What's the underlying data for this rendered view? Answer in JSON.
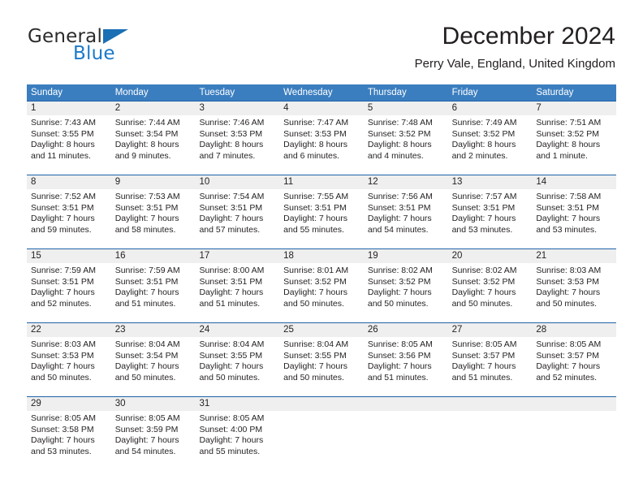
{
  "brand": {
    "name_part1": "General",
    "name_part2": "Blue",
    "triangle_color": "#1a6fb5",
    "blue_color": "#1b79c9"
  },
  "header": {
    "title": "December 2024",
    "subtitle": "Perry Vale, England, United Kingdom"
  },
  "colors": {
    "header_row_bg": "#3b7ebf",
    "week_border": "#1f63a8",
    "day_band_bg": "#efefef",
    "text": "#231f20"
  },
  "weekdays": [
    "Sunday",
    "Monday",
    "Tuesday",
    "Wednesday",
    "Thursday",
    "Friday",
    "Saturday"
  ],
  "weeks": [
    [
      {
        "day": "1",
        "sunrise": "Sunrise: 7:43 AM",
        "sunset": "Sunset: 3:55 PM",
        "daylight1": "Daylight: 8 hours",
        "daylight2": "and 11 minutes."
      },
      {
        "day": "2",
        "sunrise": "Sunrise: 7:44 AM",
        "sunset": "Sunset: 3:54 PM",
        "daylight1": "Daylight: 8 hours",
        "daylight2": "and 9 minutes."
      },
      {
        "day": "3",
        "sunrise": "Sunrise: 7:46 AM",
        "sunset": "Sunset: 3:53 PM",
        "daylight1": "Daylight: 8 hours",
        "daylight2": "and 7 minutes."
      },
      {
        "day": "4",
        "sunrise": "Sunrise: 7:47 AM",
        "sunset": "Sunset: 3:53 PM",
        "daylight1": "Daylight: 8 hours",
        "daylight2": "and 6 minutes."
      },
      {
        "day": "5",
        "sunrise": "Sunrise: 7:48 AM",
        "sunset": "Sunset: 3:52 PM",
        "daylight1": "Daylight: 8 hours",
        "daylight2": "and 4 minutes."
      },
      {
        "day": "6",
        "sunrise": "Sunrise: 7:49 AM",
        "sunset": "Sunset: 3:52 PM",
        "daylight1": "Daylight: 8 hours",
        "daylight2": "and 2 minutes."
      },
      {
        "day": "7",
        "sunrise": "Sunrise: 7:51 AM",
        "sunset": "Sunset: 3:52 PM",
        "daylight1": "Daylight: 8 hours",
        "daylight2": "and 1 minute."
      }
    ],
    [
      {
        "day": "8",
        "sunrise": "Sunrise: 7:52 AM",
        "sunset": "Sunset: 3:51 PM",
        "daylight1": "Daylight: 7 hours",
        "daylight2": "and 59 minutes."
      },
      {
        "day": "9",
        "sunrise": "Sunrise: 7:53 AM",
        "sunset": "Sunset: 3:51 PM",
        "daylight1": "Daylight: 7 hours",
        "daylight2": "and 58 minutes."
      },
      {
        "day": "10",
        "sunrise": "Sunrise: 7:54 AM",
        "sunset": "Sunset: 3:51 PM",
        "daylight1": "Daylight: 7 hours",
        "daylight2": "and 57 minutes."
      },
      {
        "day": "11",
        "sunrise": "Sunrise: 7:55 AM",
        "sunset": "Sunset: 3:51 PM",
        "daylight1": "Daylight: 7 hours",
        "daylight2": "and 55 minutes."
      },
      {
        "day": "12",
        "sunrise": "Sunrise: 7:56 AM",
        "sunset": "Sunset: 3:51 PM",
        "daylight1": "Daylight: 7 hours",
        "daylight2": "and 54 minutes."
      },
      {
        "day": "13",
        "sunrise": "Sunrise: 7:57 AM",
        "sunset": "Sunset: 3:51 PM",
        "daylight1": "Daylight: 7 hours",
        "daylight2": "and 53 minutes."
      },
      {
        "day": "14",
        "sunrise": "Sunrise: 7:58 AM",
        "sunset": "Sunset: 3:51 PM",
        "daylight1": "Daylight: 7 hours",
        "daylight2": "and 53 minutes."
      }
    ],
    [
      {
        "day": "15",
        "sunrise": "Sunrise: 7:59 AM",
        "sunset": "Sunset: 3:51 PM",
        "daylight1": "Daylight: 7 hours",
        "daylight2": "and 52 minutes."
      },
      {
        "day": "16",
        "sunrise": "Sunrise: 7:59 AM",
        "sunset": "Sunset: 3:51 PM",
        "daylight1": "Daylight: 7 hours",
        "daylight2": "and 51 minutes."
      },
      {
        "day": "17",
        "sunrise": "Sunrise: 8:00 AM",
        "sunset": "Sunset: 3:51 PM",
        "daylight1": "Daylight: 7 hours",
        "daylight2": "and 51 minutes."
      },
      {
        "day": "18",
        "sunrise": "Sunrise: 8:01 AM",
        "sunset": "Sunset: 3:52 PM",
        "daylight1": "Daylight: 7 hours",
        "daylight2": "and 50 minutes."
      },
      {
        "day": "19",
        "sunrise": "Sunrise: 8:02 AM",
        "sunset": "Sunset: 3:52 PM",
        "daylight1": "Daylight: 7 hours",
        "daylight2": "and 50 minutes."
      },
      {
        "day": "20",
        "sunrise": "Sunrise: 8:02 AM",
        "sunset": "Sunset: 3:52 PM",
        "daylight1": "Daylight: 7 hours",
        "daylight2": "and 50 minutes."
      },
      {
        "day": "21",
        "sunrise": "Sunrise: 8:03 AM",
        "sunset": "Sunset: 3:53 PM",
        "daylight1": "Daylight: 7 hours",
        "daylight2": "and 50 minutes."
      }
    ],
    [
      {
        "day": "22",
        "sunrise": "Sunrise: 8:03 AM",
        "sunset": "Sunset: 3:53 PM",
        "daylight1": "Daylight: 7 hours",
        "daylight2": "and 50 minutes."
      },
      {
        "day": "23",
        "sunrise": "Sunrise: 8:04 AM",
        "sunset": "Sunset: 3:54 PM",
        "daylight1": "Daylight: 7 hours",
        "daylight2": "and 50 minutes."
      },
      {
        "day": "24",
        "sunrise": "Sunrise: 8:04 AM",
        "sunset": "Sunset: 3:55 PM",
        "daylight1": "Daylight: 7 hours",
        "daylight2": "and 50 minutes."
      },
      {
        "day": "25",
        "sunrise": "Sunrise: 8:04 AM",
        "sunset": "Sunset: 3:55 PM",
        "daylight1": "Daylight: 7 hours",
        "daylight2": "and 50 minutes."
      },
      {
        "day": "26",
        "sunrise": "Sunrise: 8:05 AM",
        "sunset": "Sunset: 3:56 PM",
        "daylight1": "Daylight: 7 hours",
        "daylight2": "and 51 minutes."
      },
      {
        "day": "27",
        "sunrise": "Sunrise: 8:05 AM",
        "sunset": "Sunset: 3:57 PM",
        "daylight1": "Daylight: 7 hours",
        "daylight2": "and 51 minutes."
      },
      {
        "day": "28",
        "sunrise": "Sunrise: 8:05 AM",
        "sunset": "Sunset: 3:57 PM",
        "daylight1": "Daylight: 7 hours",
        "daylight2": "and 52 minutes."
      }
    ],
    [
      {
        "day": "29",
        "sunrise": "Sunrise: 8:05 AM",
        "sunset": "Sunset: 3:58 PM",
        "daylight1": "Daylight: 7 hours",
        "daylight2": "and 53 minutes."
      },
      {
        "day": "30",
        "sunrise": "Sunrise: 8:05 AM",
        "sunset": "Sunset: 3:59 PM",
        "daylight1": "Daylight: 7 hours",
        "daylight2": "and 54 minutes."
      },
      {
        "day": "31",
        "sunrise": "Sunrise: 8:05 AM",
        "sunset": "Sunset: 4:00 PM",
        "daylight1": "Daylight: 7 hours",
        "daylight2": "and 55 minutes."
      },
      {
        "day": "",
        "sunrise": "",
        "sunset": "",
        "daylight1": "",
        "daylight2": ""
      },
      {
        "day": "",
        "sunrise": "",
        "sunset": "",
        "daylight1": "",
        "daylight2": ""
      },
      {
        "day": "",
        "sunrise": "",
        "sunset": "",
        "daylight1": "",
        "daylight2": ""
      },
      {
        "day": "",
        "sunrise": "",
        "sunset": "",
        "daylight1": "",
        "daylight2": ""
      }
    ]
  ]
}
